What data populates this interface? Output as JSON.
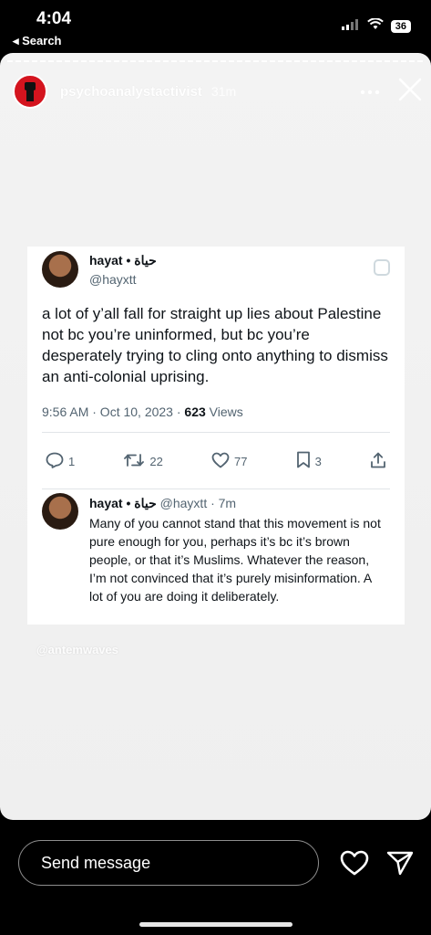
{
  "status_bar": {
    "time": "4:04",
    "back_label": "◂ Search",
    "battery": "36"
  },
  "story": {
    "username": "psychoanalystactivist",
    "time_ago": "31m",
    "watermark": "@antemwaves"
  },
  "tweet": {
    "display_name": "hayat • حياة",
    "handle": "@hayxtt",
    "text": "a lot of y’all fall for straight up lies about Palestine not bc you’re uninformed, but bc you’re desperately trying to cling onto anything to dismiss an anti-colonial uprising.",
    "meta_date": "9:56 AM · Oct 10, 2023 · ",
    "views_count": "623",
    "views_label": " Views",
    "replies": "1",
    "retweets": "22",
    "likes": "77",
    "bookmarks": "3"
  },
  "reply": {
    "display_name": "hayat • حياة",
    "meta": " @hayxtt · 7m",
    "text": "Many of you cannot stand that this movement is not pure enough for you, perhaps it’s bc it’s brown people, or that it’s Muslims. Whatever the reason, I’m not convinced that it’s purely misinformation. A lot of you are doing it deliberately."
  },
  "bottom": {
    "send_placeholder": "Send message"
  },
  "colors": {
    "story_avatar": "#d4141e",
    "twitter_gray": "#536471",
    "twitter_text": "#0f1419"
  }
}
